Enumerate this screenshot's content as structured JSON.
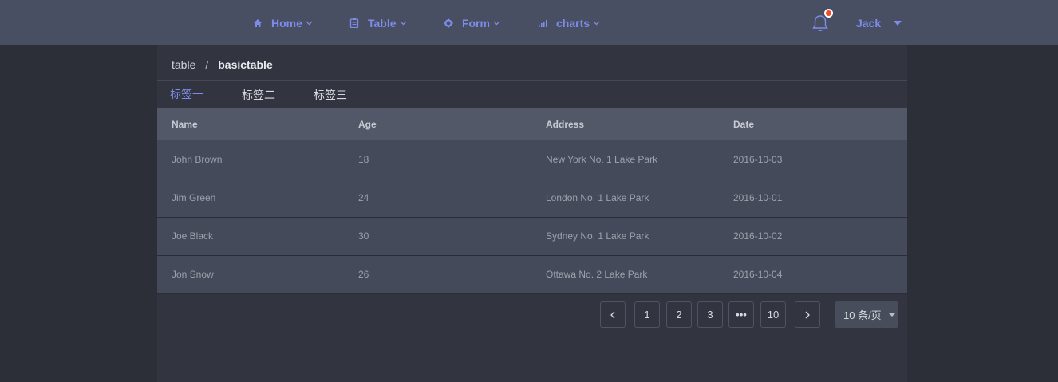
{
  "nav": {
    "items": [
      {
        "label": "Home",
        "icon": "home-icon"
      },
      {
        "label": "Table",
        "icon": "clipboard-icon"
      },
      {
        "label": "Form",
        "icon": "gear-icon"
      },
      {
        "label": "charts",
        "icon": "bar-chart-icon"
      }
    ],
    "user": "Jack",
    "notification_icon": "bell-icon"
  },
  "breadcrumb": {
    "parent": "table",
    "separator": "/",
    "current": "basictable"
  },
  "tabs": [
    "标签一",
    "标签二",
    "标签三"
  ],
  "table": {
    "columns": [
      "Name",
      "Age",
      "Address",
      "Date"
    ],
    "rows": [
      [
        "John Brown",
        "18",
        "New York No. 1 Lake Park",
        "2016-10-03"
      ],
      [
        "Jim Green",
        "24",
        "London No. 1 Lake Park",
        "2016-10-01"
      ],
      [
        "Joe Black",
        "30",
        "Sydney No. 1 Lake Park",
        "2016-10-02"
      ],
      [
        "Jon Snow",
        "26",
        "Ottawa No. 2 Lake Park",
        "2016-10-04"
      ]
    ]
  },
  "pagination": {
    "pages": [
      "1",
      "2",
      "3",
      "•••",
      "10"
    ],
    "page_size": "10 条/页"
  },
  "colors": {
    "accent": "#7d8ce8",
    "topbar": "#484f63",
    "notification_dot": "#f24b2a"
  }
}
